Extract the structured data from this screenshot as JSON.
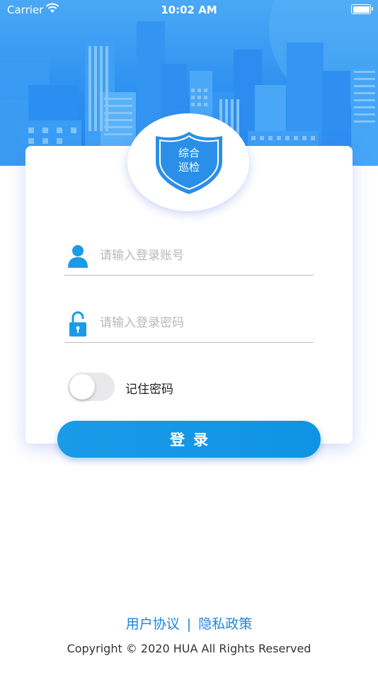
{
  "status_bar": {
    "carrier": "Carrier",
    "time": "10:02 AM"
  },
  "logo": {
    "line1": "综合",
    "line2": "巡检"
  },
  "form": {
    "username_placeholder": "请输入登录账号",
    "password_placeholder": "请输入登录密码",
    "remember_label": "记住密码",
    "remember_checked": false,
    "login_label": "登录"
  },
  "footer": {
    "user_agreement": "用户协议",
    "separator": "|",
    "privacy_policy": "隐私政策",
    "copyright": "Copyright © 2020 HUA All Rights Reserved"
  },
  "colors": {
    "accent": "#1a9be8",
    "hero": "#2b8ef0",
    "link": "#1b86e0"
  }
}
